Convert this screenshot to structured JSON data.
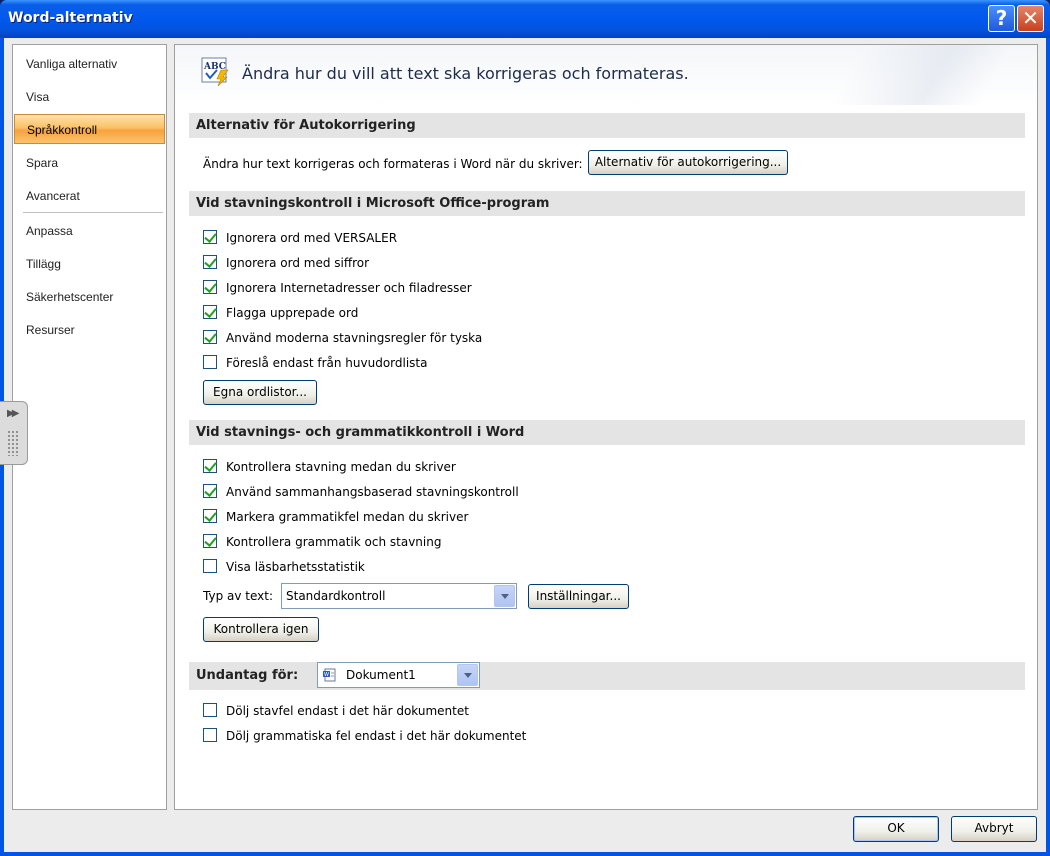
{
  "window": {
    "title": "Word-alternativ",
    "help_glyph": "?",
    "close_glyph": "✕"
  },
  "nav": {
    "items": [
      {
        "label": "Vanliga alternativ",
        "active": false
      },
      {
        "label": "Visa",
        "active": false
      },
      {
        "label": "Språkkontroll",
        "active": true
      },
      {
        "label": "Spara",
        "active": false
      },
      {
        "label": "Avancerat",
        "active": false
      },
      {
        "label": "Anpassa",
        "active": false
      },
      {
        "label": "Tillägg",
        "active": false
      },
      {
        "label": "Säkerhetscenter",
        "active": false
      },
      {
        "label": "Resurser",
        "active": false
      }
    ]
  },
  "header": {
    "text": "Ändra hur du vill att text ska korrigeras och formateras.",
    "icon": "abc-spellcheck-icon"
  },
  "autocorrect": {
    "section_title": "Alternativ för Autokorrigering",
    "description": "Ändra hur text korrigeras och formateras i Word när du skriver:",
    "button_label": "Alternativ för autokorrigering..."
  },
  "office_spelling": {
    "section_title": "Vid stavningskontroll i Microsoft Office-program",
    "options": [
      {
        "label": "Ignorera ord med VERSALER",
        "checked": true
      },
      {
        "label": "Ignorera ord med siffror",
        "checked": true
      },
      {
        "label": "Ignorera Internetadresser och filadresser",
        "checked": true
      },
      {
        "label": "Flagga upprepade ord",
        "checked": true
      },
      {
        "label": "Använd moderna stavningsregler för tyska",
        "checked": true
      },
      {
        "label": "Föreslå endast från huvudordlista",
        "checked": false
      }
    ],
    "custom_dict_button": "Egna ordlistor..."
  },
  "word_spelling": {
    "section_title": "Vid stavnings- och grammatikkontroll i Word",
    "options": [
      {
        "label": "Kontrollera stavning medan du skriver",
        "checked": true
      },
      {
        "label": "Använd sammanhangsbaserad stavningskontroll",
        "checked": true
      },
      {
        "label": "Markera grammatikfel medan du skriver",
        "checked": true
      },
      {
        "label": "Kontrollera grammatik och stavning",
        "checked": true
      },
      {
        "label": "Visa läsbarhetsstatistik",
        "checked": false
      }
    ],
    "writing_style_label": "Typ av text:",
    "writing_style_value": "Standardkontroll",
    "settings_button": "Inställningar...",
    "recheck_button": "Kontrollera igen"
  },
  "exceptions": {
    "section_title": "Undantag för:",
    "document_value": "Dokument1",
    "options": [
      {
        "label": "Dölj stavfel endast i det här dokumentet",
        "checked": false
      },
      {
        "label": "Dölj grammatiska fel endast i det här dokumentet",
        "checked": false
      }
    ]
  },
  "footer": {
    "ok_label": "OK",
    "cancel_label": "Avbryt"
  },
  "colors": {
    "titlebar": "#0055e5",
    "nav_active": "#f7a23c",
    "check": "#21a121"
  }
}
